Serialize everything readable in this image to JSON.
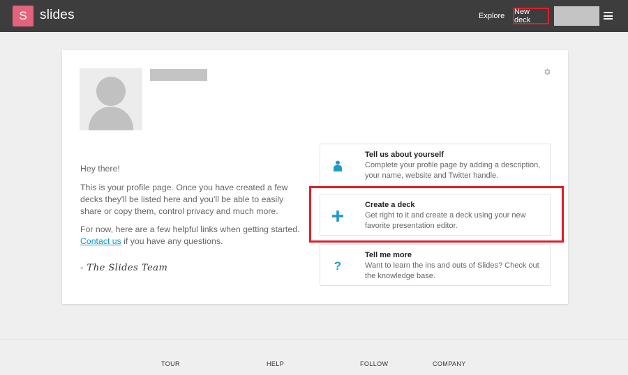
{
  "header": {
    "logo_letter": "S",
    "logo_text": "slides",
    "nav_explore": "Explore",
    "nav_new_deck": "New deck"
  },
  "profile": {
    "greeting": "Hey there!",
    "intro": "This is your profile page. Once you have created a few decks they'll be listed here and you'll be able to easily share or copy them, control privacy and much more.",
    "helpful_prefix": "For now, here are a few helpful links when getting started.",
    "contact_link": "Contact us",
    "helpful_suffix": " if you have any questions.",
    "signature": "- The Slides Team"
  },
  "help_items": [
    {
      "icon": "person-icon",
      "title": "Tell us about yourself",
      "description": "Complete your profile page by adding a description, your name, website and Twitter handle."
    },
    {
      "icon": "plus-icon",
      "title": "Create a deck",
      "description": "Get right to it and create a deck using your new favorite presentation editor."
    },
    {
      "icon": "question-icon",
      "title": "Tell me more",
      "description": "Want to learn the ins and outs of Slides? Check out the knowledge base."
    }
  ],
  "footer": {
    "links": [
      "TOUR",
      "HELP",
      "FOLLOW",
      "COMPANY"
    ]
  },
  "colors": {
    "brand": "#e4637c",
    "accent": "#1f9ac7",
    "highlight": "#e01e2a"
  }
}
